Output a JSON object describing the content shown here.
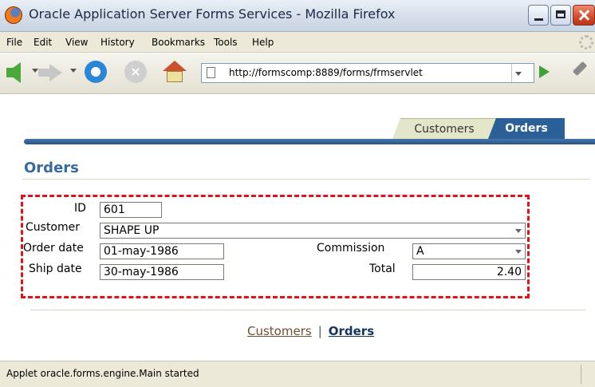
{
  "window": {
    "title": "Oracle Application Server Forms Services - Mozilla Firefox"
  },
  "menu": {
    "items": [
      "File",
      "Edit",
      "View",
      "History",
      "Bookmarks",
      "Tools",
      "Help"
    ]
  },
  "toolbar": {
    "url": "http://formscomp:8889/forms/frmservlet",
    "icons": [
      "back-icon",
      "forward-icon",
      "reload-icon",
      "stop-icon",
      "home-icon",
      "go-icon",
      "pen-icon"
    ]
  },
  "tabs": {
    "customers": "Customers",
    "orders": "Orders",
    "active": "Orders"
  },
  "page": {
    "heading": "Orders"
  },
  "form": {
    "id_label": "ID",
    "id_value": "601",
    "customer_label": "Customer",
    "customer_value": "SHAPE UP",
    "order_date_label": "Order date",
    "order_date_value": "01-may-1986",
    "ship_date_label": "Ship date",
    "ship_date_value": "30-may-1986",
    "commission_label": "Commission",
    "commission_value": "A",
    "total_label": "Total",
    "total_value": "2.40"
  },
  "footer": {
    "customers_link": "Customers",
    "separator": "|",
    "orders_link": "Orders"
  },
  "status": {
    "text": "Applet oracle.forms.engine.Main started"
  },
  "colors": {
    "accent": "#35699f",
    "tab_active": "#2b5f97",
    "highlight_border": "#e0121a"
  }
}
